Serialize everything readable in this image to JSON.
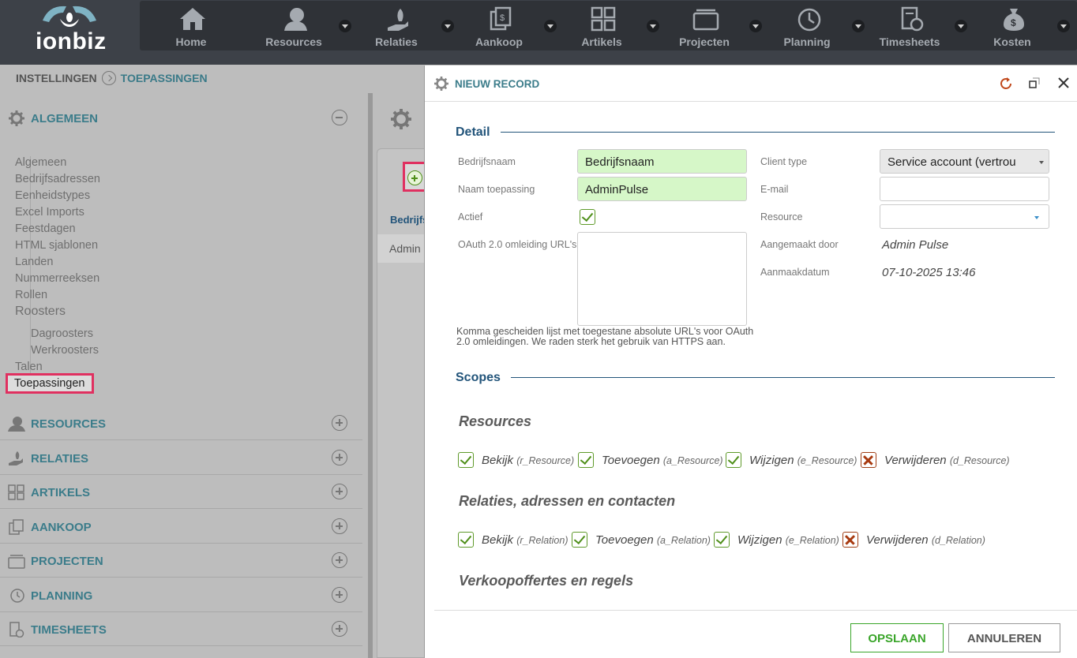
{
  "app": {
    "logo_text": "ionbiz"
  },
  "nav": [
    {
      "label": "Home",
      "icon": "home-icon",
      "dropdown": false
    },
    {
      "label": "Resources",
      "icon": "user-icon",
      "dropdown": true
    },
    {
      "label": "Relaties",
      "icon": "hand-plant-icon",
      "dropdown": true
    },
    {
      "label": "Aankoop",
      "icon": "invoice-icon",
      "dropdown": true
    },
    {
      "label": "Artikels",
      "icon": "grid-icon",
      "dropdown": true
    },
    {
      "label": "Projecten",
      "icon": "folder-icon",
      "dropdown": true
    },
    {
      "label": "Planning",
      "icon": "clock-icon",
      "dropdown": true
    },
    {
      "label": "Timesheets",
      "icon": "timesheet-icon",
      "dropdown": true
    },
    {
      "label": "Kosten",
      "icon": "money-bag-icon",
      "dropdown": true
    }
  ],
  "breadcrumb": {
    "root": "INSTELLINGEN",
    "current": "TOEPASSINGEN"
  },
  "sidebar": {
    "algemeen_title": "ALGEMEEN",
    "items": {
      "algemeen": "Algemeen",
      "bedrijfsadressen": "Bedrijfsadressen",
      "eenheidstypes": "Eenheidstypes",
      "excel_imports": "Excel Imports",
      "feestdagen": "Feestdagen",
      "html_sjablonen": "HTML sjablonen",
      "landen": "Landen",
      "nummerreeksen": "Nummerreeksen",
      "rollen": "Rollen",
      "roosters": "Roosters",
      "dagroosters": "Dagroosters",
      "werkroosters": "Werkroosters",
      "talen": "Talen",
      "toepassingen": "Toepassingen"
    },
    "sections": {
      "resources": "RESOURCES",
      "relaties": "RELATIES",
      "artikels": "ARTIKELS",
      "aankoop": "AANKOOP",
      "projecten": "PROJECTEN",
      "planning": "PLANNING",
      "timesheets": "TIMESHEETS"
    }
  },
  "middle": {
    "col_header": "Bedrijfs",
    "row_value": "Admin"
  },
  "dialog": {
    "title": "NIEUW RECORD",
    "detail_title": "Detail",
    "fields": {
      "bedrijfsnaam_label": "Bedrijfsnaam",
      "bedrijfsnaam_value": "Bedrijfsnaam",
      "naam_label": "Naam toepassing",
      "naam_value": "AdminPulse",
      "actief_label": "Actief",
      "oauth_label": "OAuth 2.0 omleiding URL's",
      "oauth_help": "Komma gescheiden lijst met toegestane absolute URL's voor OAuth 2.0 omleidingen. We raden sterk het gebruik van HTTPS aan.",
      "client_type_label": "Client type",
      "client_type_value": "Service account (vertrou",
      "email_label": "E-mail",
      "email_value": "",
      "resource_label": "Resource",
      "resource_value": "",
      "aangemaakt_label": "Aangemaakt door",
      "aangemaakt_value": "Admin Pulse",
      "datum_label": "Aanmaakdatum",
      "datum_value": "07-10-2025 13:46"
    },
    "scopes_title": "Scopes",
    "scope_groups": {
      "resources": {
        "title": "Resources",
        "items": [
          {
            "label": "Bekijk",
            "code": "(r_Resource)",
            "checked": true
          },
          {
            "label": "Toevoegen",
            "code": "(a_Resource)",
            "checked": true
          },
          {
            "label": "Wijzigen",
            "code": "(e_Resource)",
            "checked": true
          },
          {
            "label": "Verwijderen",
            "code": "(d_Resource)",
            "checked": false
          }
        ]
      },
      "relaties": {
        "title": "Relaties, adressen en contacten",
        "items": [
          {
            "label": "Bekijk",
            "code": "(r_Relation)",
            "checked": true
          },
          {
            "label": "Toevoegen",
            "code": "(a_Relation)",
            "checked": true
          },
          {
            "label": "Wijzigen",
            "code": "(e_Relation)",
            "checked": true
          },
          {
            "label": "Verwijderen",
            "code": "(d_Relation)",
            "checked": false
          }
        ]
      },
      "verkoop": {
        "title": "Verkoopoffertes en regels"
      }
    },
    "save_label": "OPSLAAN",
    "cancel_label": "ANNULEREN"
  },
  "colors": {
    "accent": "#3b7c8a",
    "save_green": "#3aa52a",
    "highlight": "#e03060"
  }
}
